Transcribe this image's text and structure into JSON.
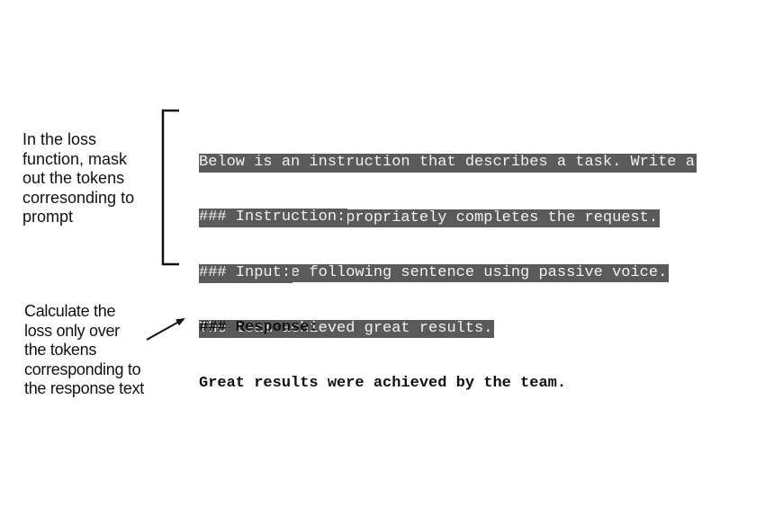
{
  "annotations": {
    "mask_note": "In the loss\nfunction, mask\nout the tokens\ncorresonding to\nprompt",
    "loss_note": "Calculate the\nloss only over\nthe tokens\ncorresponding to\nthe response text"
  },
  "prompt": {
    "preamble": [
      "Below is an instruction that describes a task. Write a",
      "response that appropriately completes the request."
    ],
    "instruction": [
      "### Instruction:",
      "Rewrite the following sentence using passive voice."
    ],
    "input": [
      "### Input:",
      "The team achieved great results."
    ]
  },
  "response": [
    "### Response:",
    "Great results were achieved by the team."
  ],
  "colors": {
    "mask_highlight": "#5a5a5a",
    "mask_text": "#f2f2f2",
    "ink": "#111111"
  }
}
